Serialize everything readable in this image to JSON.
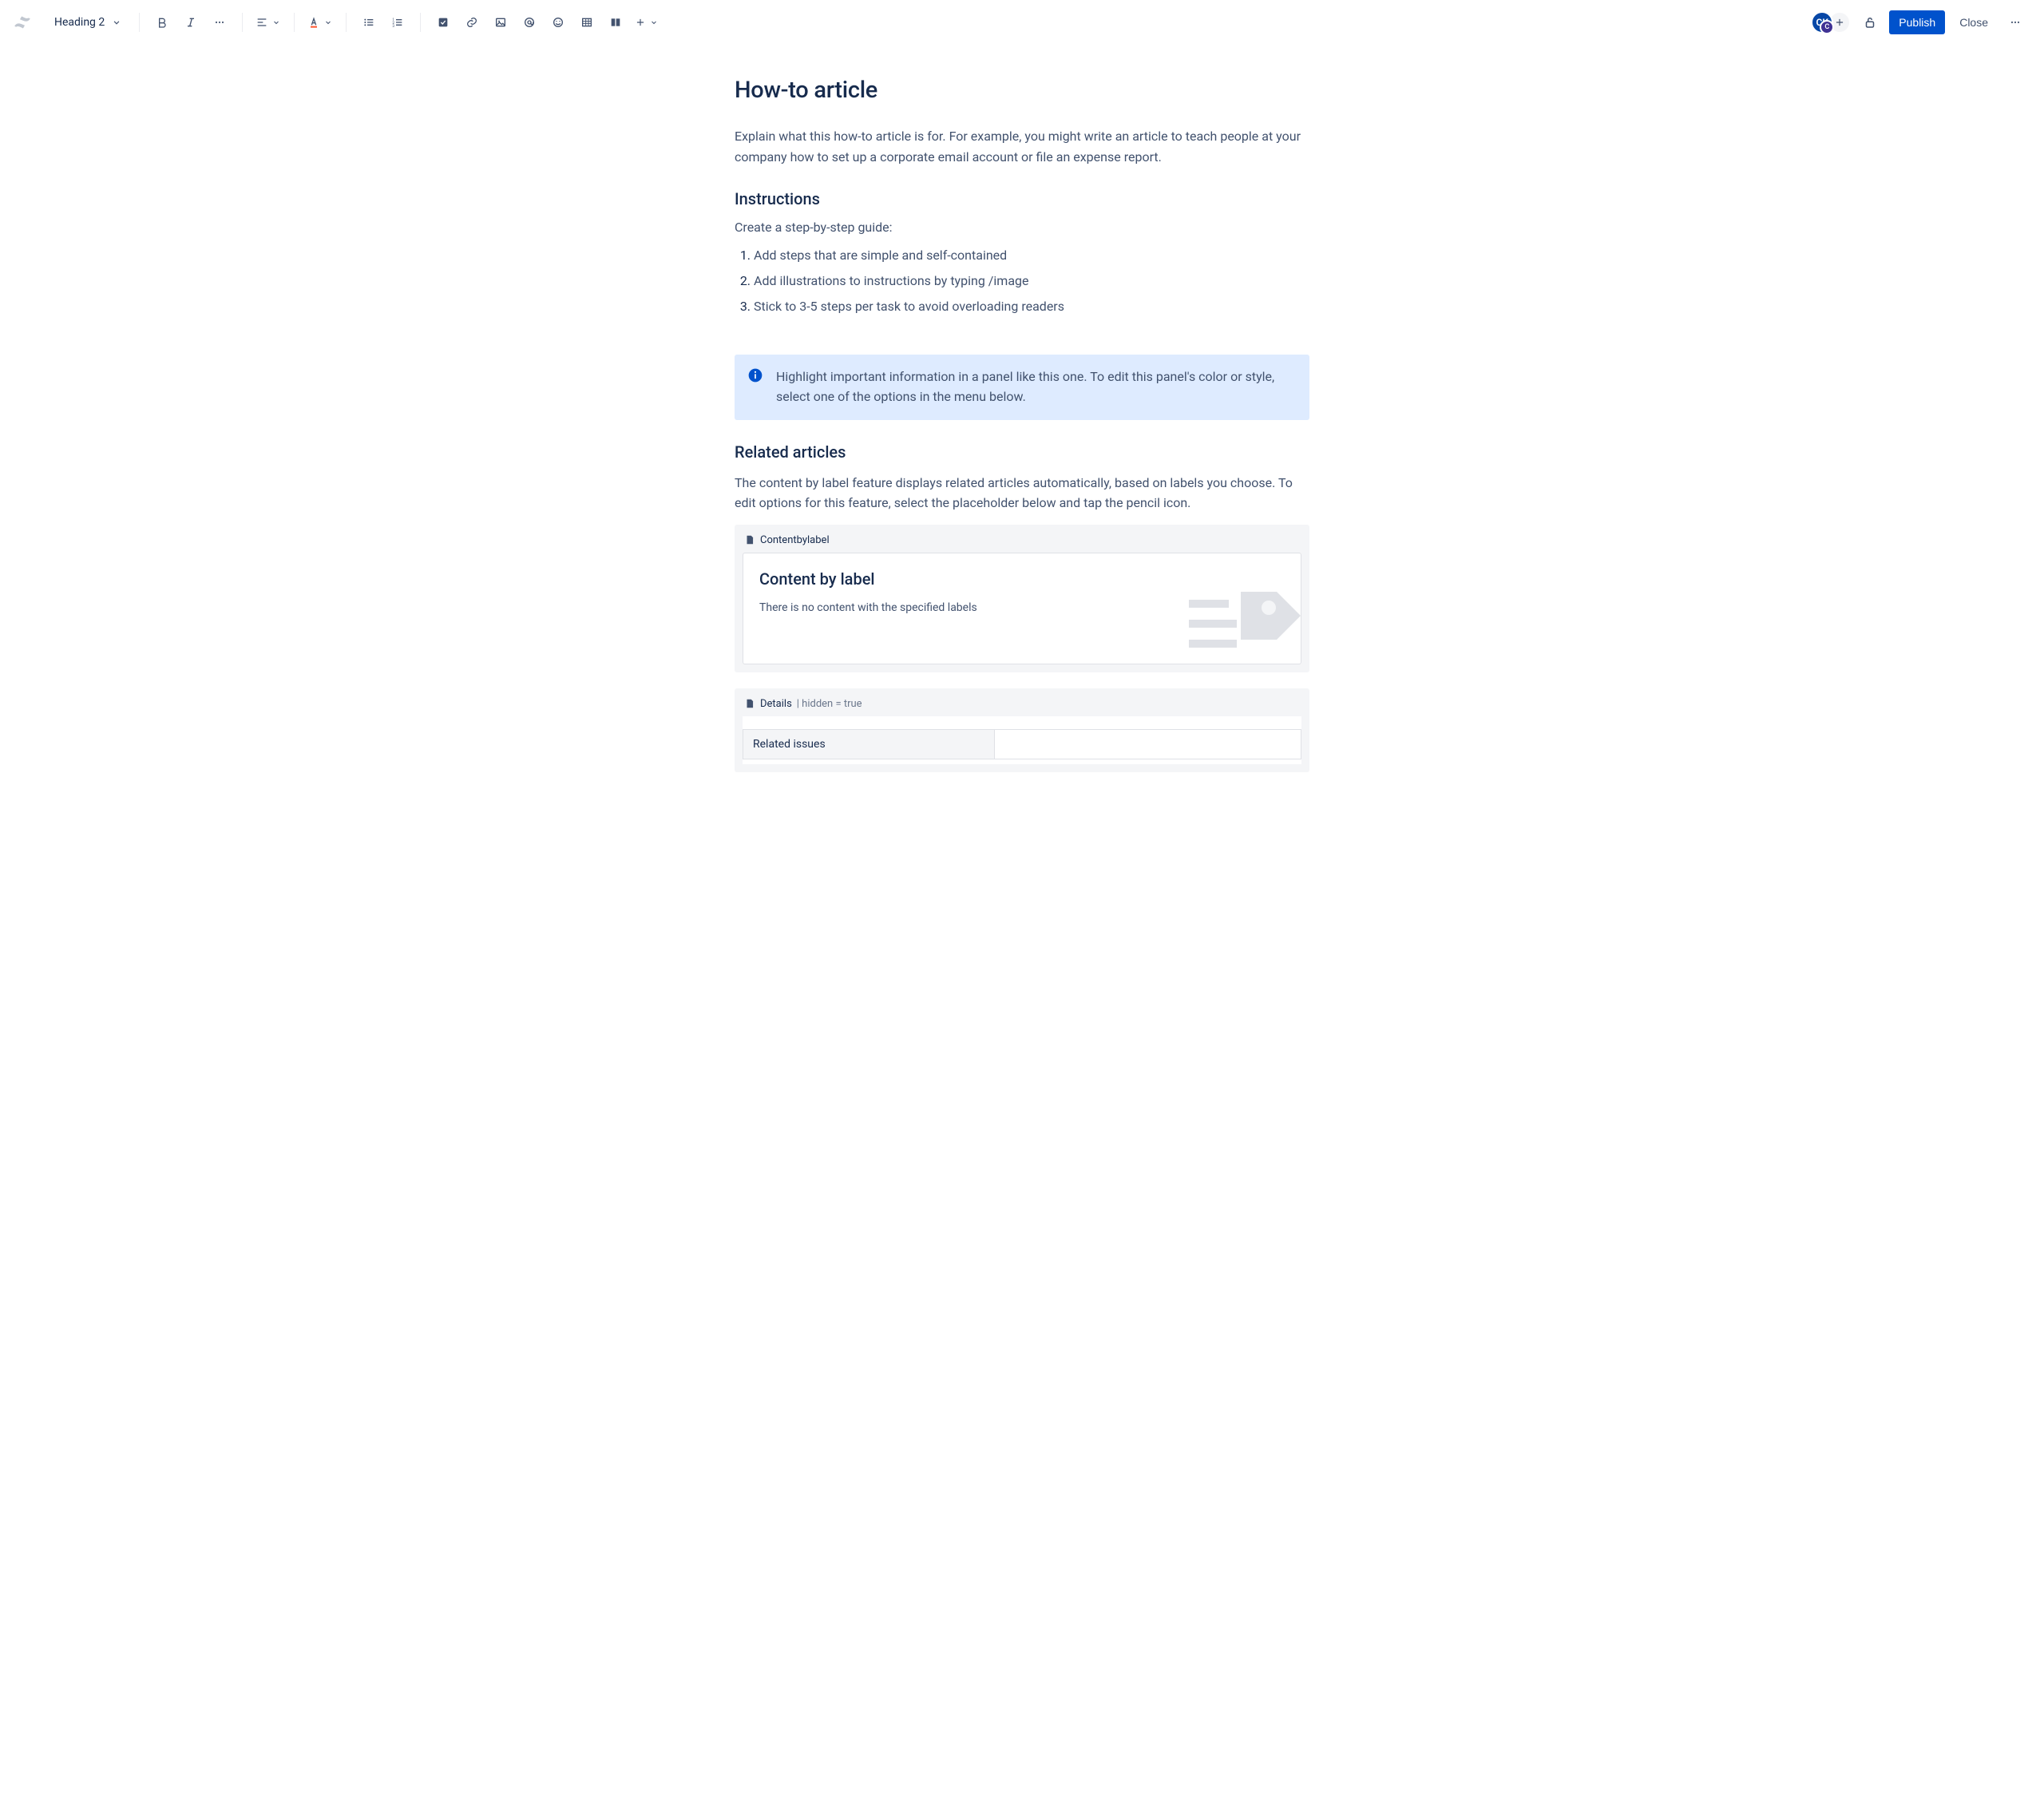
{
  "toolbar": {
    "heading_style": "Heading 2",
    "publish_label": "Publish",
    "close_label": "Close",
    "avatar_initials": "CK",
    "avatar_badge": "C"
  },
  "page": {
    "title": "How-to article",
    "intro": "Explain what this how-to article is for. For example, you might write an article to teach people at your company how to set up a corporate email account or file an expense report.",
    "instructions_heading": "Instructions",
    "instructions_sub": "Create a step-by-step guide:",
    "steps": [
      "Add steps that are simple and self-contained",
      "Add illustrations to instructions by typing /image",
      "Stick to 3-5 steps per task to avoid overloading readers"
    ],
    "panel_text": "Highlight important information in a panel like this one. To edit this panel's color or style, select one of the options in the menu below.",
    "related_heading": "Related articles",
    "related_desc": "The content by label feature displays related articles automatically, based on labels you choose. To edit options for this feature, select the placeholder below and tap the pencil icon.",
    "cbl_macro_name": "Contentbylabel",
    "cbl_title": "Content by label",
    "cbl_empty": "There is no content with the specified labels",
    "details_macro_name": "Details",
    "details_meta": "| hidden = true",
    "details_row_label": "Related issues",
    "details_row_value": ""
  }
}
